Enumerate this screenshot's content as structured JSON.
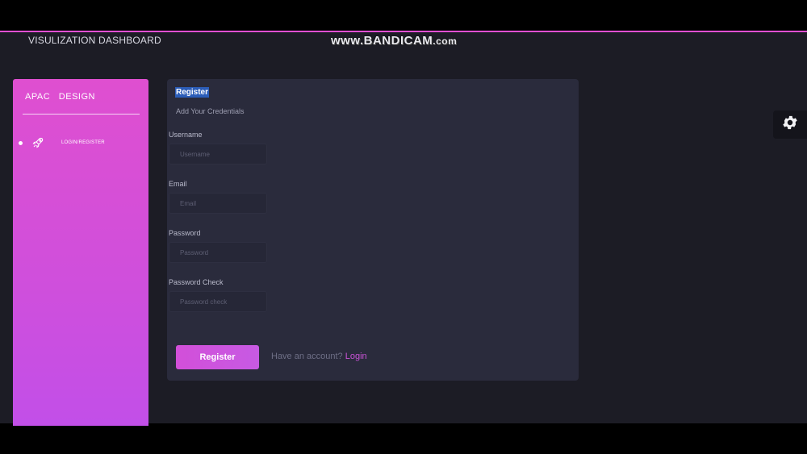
{
  "app": {
    "title": "VISULIZATION DASHBOARD",
    "watermark_main": "www.BANDICAM",
    "watermark_suffix": ".com"
  },
  "sidebar": {
    "brand": "APAC   DESIGN",
    "items": [
      {
        "label": "LOGIN/REGISTER",
        "icon": "rocket-icon",
        "active": true
      }
    ]
  },
  "form": {
    "title": "Register",
    "subtitle": "Add Your Credentials",
    "fields": [
      {
        "label": "Username",
        "placeholder": "Username",
        "value": ""
      },
      {
        "label": "Email",
        "placeholder": "Email",
        "value": ""
      },
      {
        "label": "Password",
        "placeholder": "Password",
        "value": ""
      },
      {
        "label": "Password Check",
        "placeholder": "Password check",
        "value": ""
      }
    ],
    "submit_label": "Register",
    "account_prompt": "Have an account?",
    "login_label": "Login"
  },
  "colors": {
    "accent": "#df4fd0",
    "background": "#1c1c25",
    "card": "#2a2b3c"
  },
  "settings": {
    "icon": "gear-icon"
  }
}
